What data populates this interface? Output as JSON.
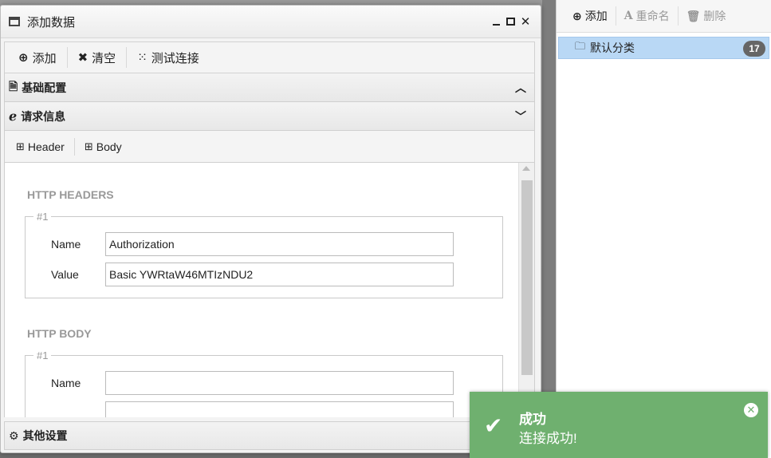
{
  "window": {
    "title": "添加数据",
    "minimize_icon": "minimize-icon",
    "maximize_icon": "maximize-icon",
    "close_glyph": "✕"
  },
  "toolbar": {
    "add_label": "添加",
    "clear_label": "清空",
    "test_label": "测试连接"
  },
  "sections": {
    "basic": "基础配置",
    "request": "请求信息",
    "other": "其他设置"
  },
  "tabs": [
    {
      "label": "Header"
    },
    {
      "label": "Body"
    }
  ],
  "headers": {
    "title": "HTTP HEADERS",
    "legend": "#1",
    "name_label": "Name",
    "value_label": "Value",
    "name_value": "Authorization",
    "value_value": "Basic YWRtaW46MTIzNDU2"
  },
  "body": {
    "title": "HTTP BODY",
    "legend": "#1",
    "name_label": "Name",
    "name_value": ""
  },
  "right_panel": {
    "add_label": "添加",
    "rename_label": "重命名",
    "delete_label": "删除",
    "categories": [
      {
        "label": "默认分类",
        "count": "17"
      }
    ]
  },
  "toast": {
    "title": "成功",
    "message": "连接成功!"
  },
  "colors": {
    "toast_bg": "#6fb06f",
    "selected_row": "#b9d8f5",
    "badge": "#666666"
  }
}
